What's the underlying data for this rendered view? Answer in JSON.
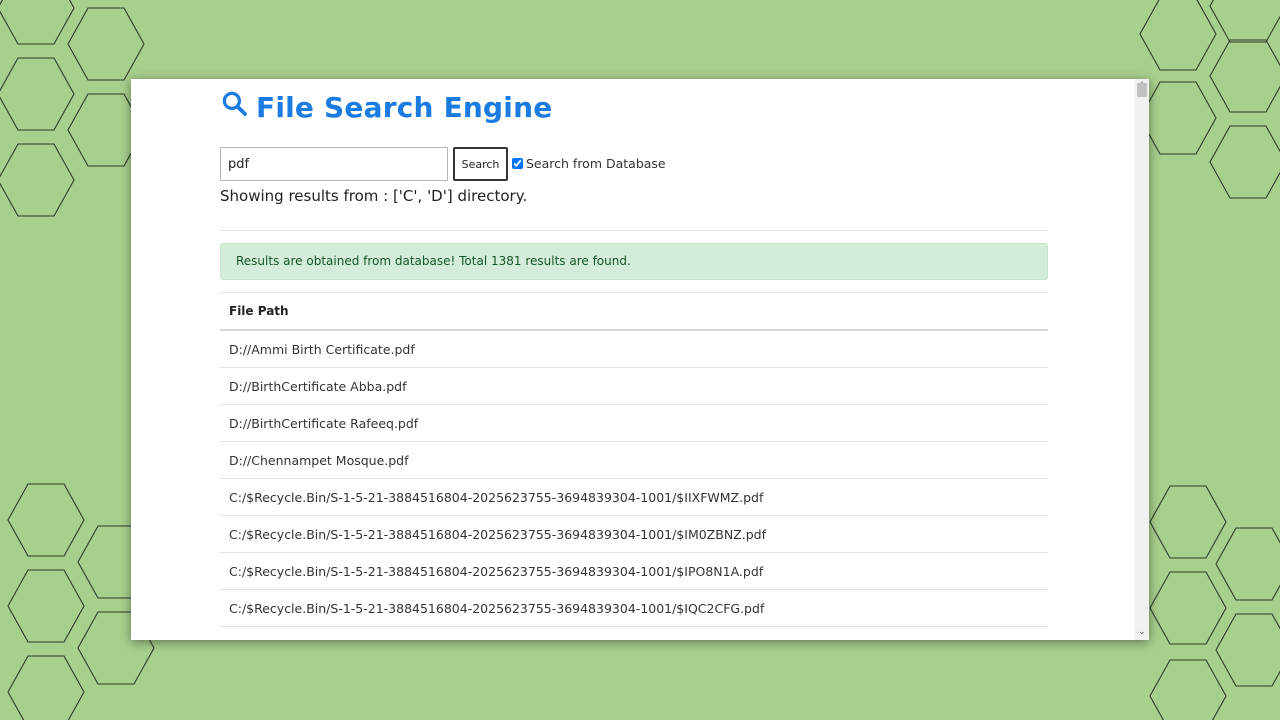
{
  "app": {
    "title": "File Search Engine",
    "accent_color": "#1a7be0",
    "title_icon": "search-icon"
  },
  "search": {
    "value": "pdf",
    "button_label": "Search",
    "db_checkbox_checked": true,
    "db_checkbox_label": "Search from Database"
  },
  "showing_text": "Showing results from : ['C', 'D'] directory.",
  "alert": {
    "text": "Results are obtained from database! Total 1381 results are found.",
    "color": "#d4edda"
  },
  "table": {
    "header": "File Path",
    "rows": [
      "D://Ammi Birth Certificate.pdf",
      "D://BirthCertificate Abba.pdf",
      "D://BirthCertificate Rafeeq.pdf",
      "D://Chennampet Mosque.pdf",
      "C:/$Recycle.Bin/S-1-5-21-3884516804-2025623755-3694839304-1001/$IIXFWMZ.pdf",
      "C:/$Recycle.Bin/S-1-5-21-3884516804-2025623755-3694839304-1001/$IM0ZBNZ.pdf",
      "C:/$Recycle.Bin/S-1-5-21-3884516804-2025623755-3694839304-1001/$IPO8N1A.pdf",
      "C:/$Recycle.Bin/S-1-5-21-3884516804-2025623755-3694839304-1001/$IQC2CFG.pdf"
    ]
  }
}
